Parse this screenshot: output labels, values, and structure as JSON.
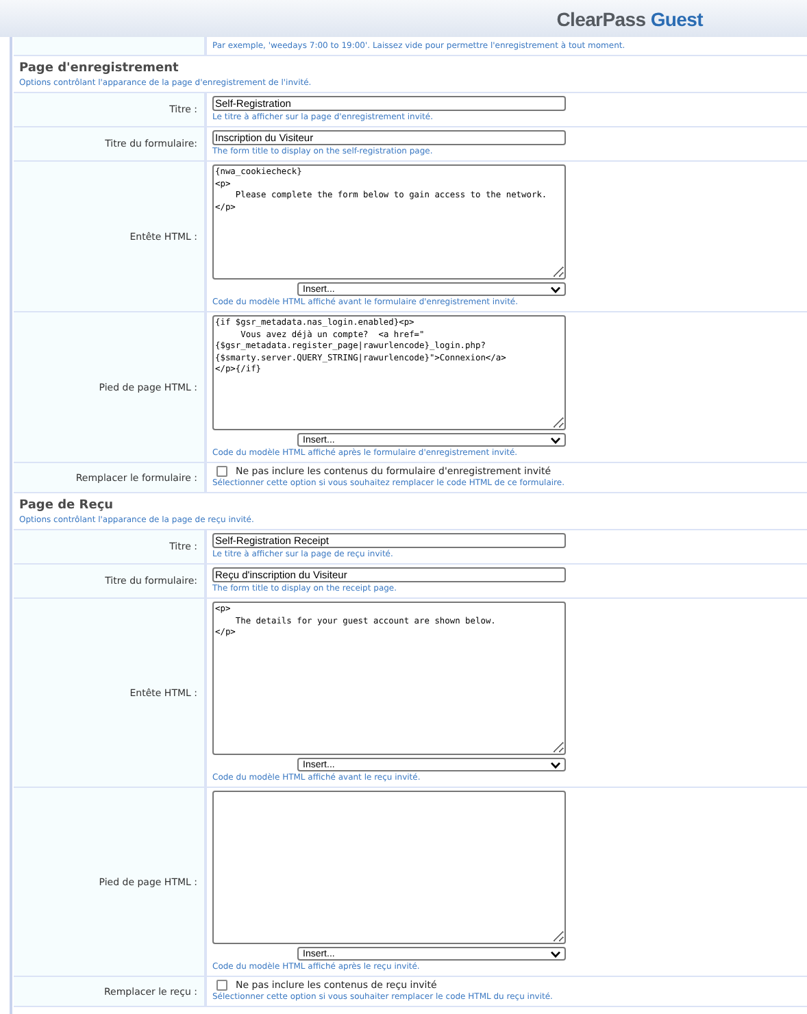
{
  "header": {
    "logo": {
      "brand": "ClearPass",
      "product": "Guest"
    }
  },
  "top_hint": "Par exemple, 'weedays 7:00 to 19:00'. Laissez vide pour permettre l'enregistrement à tout moment.",
  "sections": [
    {
      "title": "Page d'enregistrement",
      "description": "Options contrôlant l'apparance de la page d'enregistrement de l'invité.",
      "rows": [
        {
          "kind": "text",
          "label": "Titre :",
          "value": "Self-Registration",
          "hint": "Le titre à afficher sur la page d'enregistrement invité."
        },
        {
          "kind": "text",
          "label": "Titre du formulaire:",
          "value": "Inscription du Visiteur",
          "hint": "The form title to display on the self-registration page."
        },
        {
          "kind": "textarea",
          "label": "Entête HTML :",
          "value": "{nwa_cookiecheck}\n<p>\n    Please complete the form below to gain access to the network.\n</p>",
          "select": "Insert...",
          "hint": "Code du modèle HTML affiché avant le formulaire d'enregistrement invité."
        },
        {
          "kind": "textarea",
          "label": "Pied de page HTML :",
          "value": "{if $gsr_metadata.nas_login.enabled}<p>\n     Vous avez déjà un compte?  <a href=\"\n{$gsr_metadata.register_page|rawurlencode}_login.php?\n{$smarty.server.QUERY_STRING|rawurlencode}\">Connexion</a>\n</p>{/if}",
          "select": "Insert...",
          "hint": "Code du modèle HTML affiché après le formulaire d'enregistrement invité."
        },
        {
          "kind": "checkbox",
          "label": "Remplacer le formulaire :",
          "checked": false,
          "option": "Ne pas inclure les contenus du formulaire d'enregistrement invité",
          "hint": "Sélectionner cette option si vous souhaitez remplacer le code HTML de ce formulaire."
        }
      ]
    },
    {
      "title": "Page de Reçu",
      "description": "Options contrôlant l'apparance de la page de reçu invité.",
      "rows": [
        {
          "kind": "text",
          "label": "Titre :",
          "value": "Self-Registration Receipt",
          "hint": "Le titre à afficher sur la page de reçu invité."
        },
        {
          "kind": "text",
          "label": "Titre du formulaire:",
          "value": "Reçu d'inscription du Visiteur",
          "hint": "The form title to display on the receipt page."
        },
        {
          "kind": "textarea",
          "label": "Entête HTML :",
          "value": "<p>\n    The details for your guest account are shown below.\n</p>",
          "select": "Insert...",
          "hint": "Code du modèle HTML affiché avant le reçu invité."
        },
        {
          "kind": "textarea",
          "label": "Pied de page HTML :",
          "select": "Insert...",
          "hint": "Code du modèle HTML affiché après le reçu invité."
        },
        {
          "kind": "checkbox",
          "label": "Remplacer le reçu :",
          "checked": false,
          "option": "Ne pas inclure les contenus de reçu invité",
          "hint": "Sélectionner cette option si vous souhaiter remplacer le code HTML du reçu invité."
        }
      ]
    }
  ]
}
